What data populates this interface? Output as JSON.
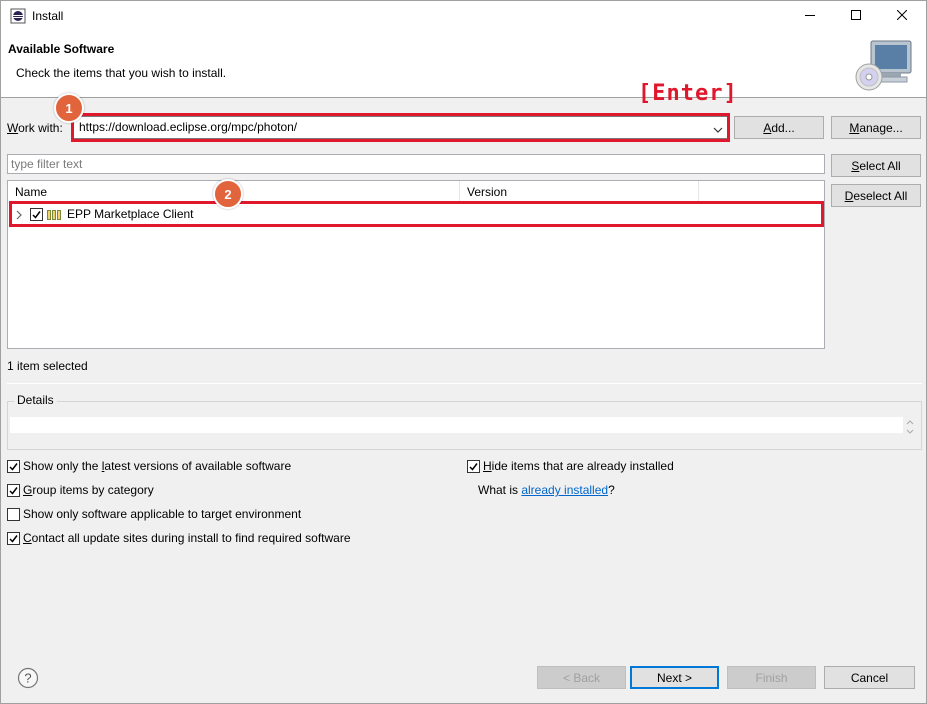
{
  "window": {
    "title": "Install",
    "minimize_icon": "minimize-icon",
    "maximize_icon": "maximize-icon",
    "close_icon": "close-icon"
  },
  "header": {
    "title": "Available Software",
    "description": "Check the items that you wish to install.",
    "image_icon": "install-wizard-icon"
  },
  "work_with": {
    "label_mnemonic": "W",
    "label_rest": "ork with:",
    "value": "https://download.eclipse.org/mpc/photon/",
    "add_mnemonic": "A",
    "add_rest": "dd...",
    "manage_mnemonic": "M",
    "manage_rest": "anage..."
  },
  "filter": {
    "placeholder": "type filter text"
  },
  "side_buttons": {
    "select_all_mnemonic": "S",
    "select_all_rest": "elect All",
    "deselect_all_mnemonic": "D",
    "deselect_all_rest": "eselect All"
  },
  "tree": {
    "columns": [
      "Name",
      "Version",
      ""
    ],
    "rows": [
      {
        "name": "EPP Marketplace Client",
        "version": "",
        "checked": true,
        "icon": "feature-group-icon"
      }
    ]
  },
  "status": {
    "selection_text": "1 item selected"
  },
  "details": {
    "label": "Details",
    "text": ""
  },
  "options_left": [
    {
      "pre": "Show only the ",
      "mnemonic": "l",
      "post": "atest versions of available software",
      "checked": true
    },
    {
      "pre": "",
      "mnemonic": "G",
      "post": "roup items by category",
      "checked": true
    },
    {
      "pre": "Show only software applicable to target environment",
      "mnemonic": "",
      "post": "",
      "checked": false
    },
    {
      "pre": "",
      "mnemonic": "C",
      "post": "ontact all update sites during install to find required software",
      "checked": true
    }
  ],
  "options_right": {
    "hide_installed": {
      "pre": "",
      "mnemonic": "H",
      "post": "ide items that are already installed",
      "checked": true
    },
    "what_is_pre": "What is ",
    "what_is_link": "already installed",
    "what_is_post": "?"
  },
  "footer": {
    "help_icon": "help-icon",
    "back_label": "< Back",
    "next_label": "Next >",
    "finish_label": "Finish",
    "cancel_label": "Cancel"
  },
  "annotations": {
    "badge1": "1",
    "badge2": "2",
    "enter_note": "[Enter]",
    "highlight_color": "#e0182d",
    "badge_color": "#e1643d"
  }
}
